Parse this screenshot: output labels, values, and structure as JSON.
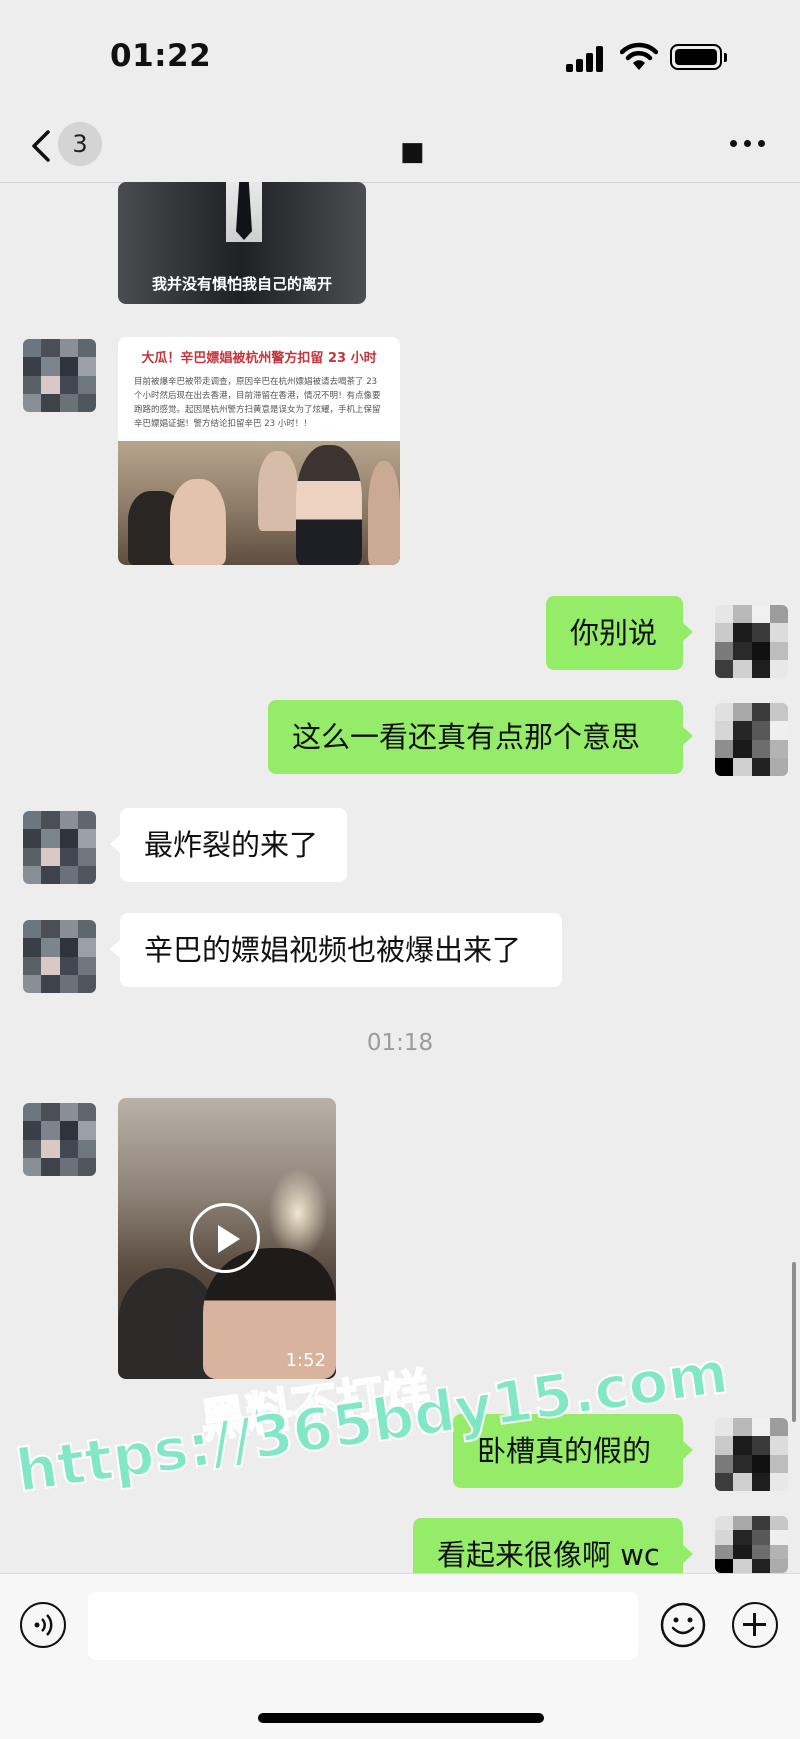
{
  "status_bar": {
    "time": "01:22"
  },
  "header": {
    "back_badge": "3",
    "title": "■"
  },
  "messages": [
    {
      "type": "image",
      "side": "in",
      "caption": "我并没有惧怕我自己的离开"
    },
    {
      "type": "image",
      "side": "in",
      "headline": "大瓜！辛巴嫖娼被杭州警方扣留 23 小时",
      "body": "目前被爆辛巴被带走调查，原因辛巴在杭州嫖娼被请去喝茶了 23 个小时然后现在出去香港，目前滞留在香港，情况不明！有点像要跑路的感觉。起因是杭州警方扫黄意是误女为了炫耀，手机上保留辛巴嫖娼证据！警方结论扣留辛巴 23 小时！！"
    },
    {
      "type": "text",
      "side": "out",
      "text": "你别说"
    },
    {
      "type": "text",
      "side": "out",
      "text": "这么一看还真有点那个意思"
    },
    {
      "type": "text",
      "side": "in",
      "text": "最炸裂的来了"
    },
    {
      "type": "text",
      "side": "in",
      "text": "辛巴的嫖娼视频也被爆出来了"
    },
    {
      "type": "timestamp",
      "text": "01:18"
    },
    {
      "type": "video",
      "side": "in",
      "duration": "1:52"
    },
    {
      "type": "text",
      "side": "out",
      "text": "卧槽真的假的"
    },
    {
      "type": "text",
      "side": "out",
      "text": "看起来很像啊 wc"
    }
  ],
  "watermark": {
    "line1": "黑料不打烊",
    "line2": "https://365bdy15.com"
  },
  "input_bar": {
    "placeholder": ""
  },
  "colors": {
    "background": "#ededed",
    "outgoing_bubble": "#95ec69",
    "incoming_bubble": "#ffffff",
    "watermark": "#7ce7c6"
  },
  "icons": [
    "back-icon",
    "more-icon",
    "voice-icon",
    "emoji-icon",
    "plus-icon",
    "play-icon"
  ]
}
